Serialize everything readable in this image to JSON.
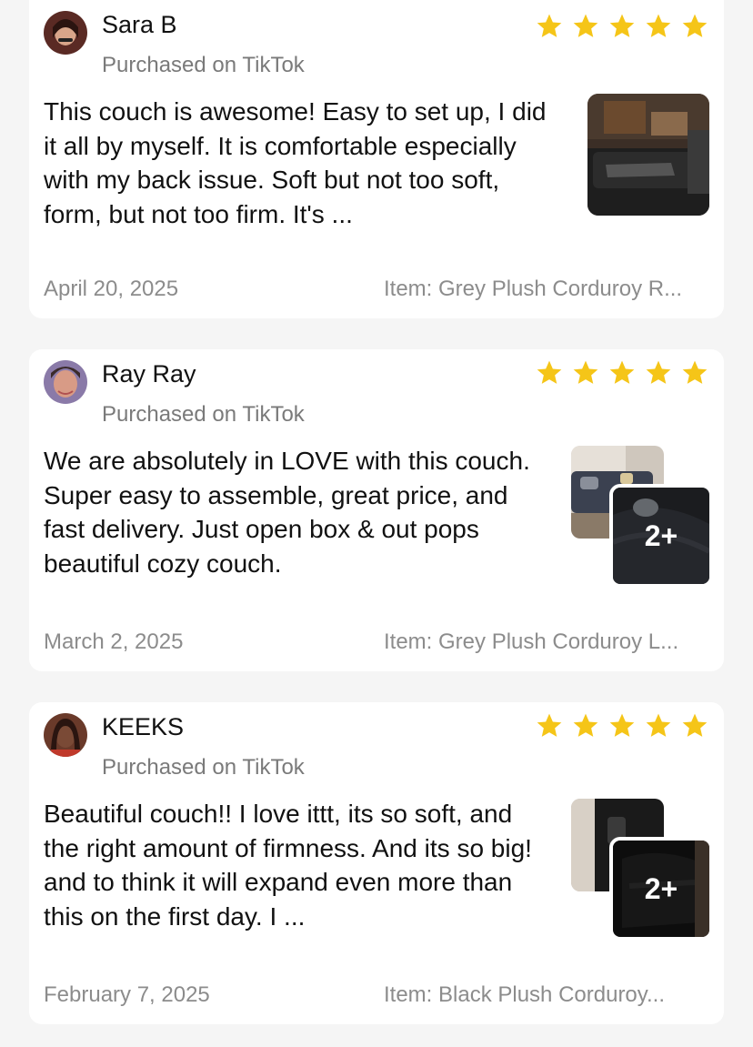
{
  "colors": {
    "star": "#F5C518",
    "muted": "#8c8c8c",
    "text": "#111111"
  },
  "reviews": [
    {
      "name": "Sara B",
      "rating": 5,
      "source": "Purchased on TikTok",
      "body": "This couch is awesome! Easy to set up, I did it all by myself. It is comfortable especially with my back issue. Soft but not too soft, form, but not too firm. It's ...",
      "date": "April 20, 2025",
      "item": "Item: Grey Plush Corduroy R...",
      "photo_more": ""
    },
    {
      "name": "Ray Ray",
      "rating": 5,
      "source": "Purchased on TikTok",
      "body": "We are absolutely in LOVE with this couch. Super easy to assemble, great price, and fast delivery. Just open box & out pops beautiful cozy couch.",
      "date": "March 2, 2025",
      "item": "Item: Grey Plush Corduroy L...",
      "photo_more": "2+"
    },
    {
      "name": "KEEKS",
      "rating": 5,
      "source": "Purchased on TikTok",
      "body": "Beautiful couch!! I love ittt, its so soft, and the right amount of firmness. And its so big! and to think it will expand even more than this on the first day. I ...",
      "date": "February 7, 2025",
      "item": "Item: Black Plush Corduroy...",
      "photo_more": "2+"
    }
  ]
}
